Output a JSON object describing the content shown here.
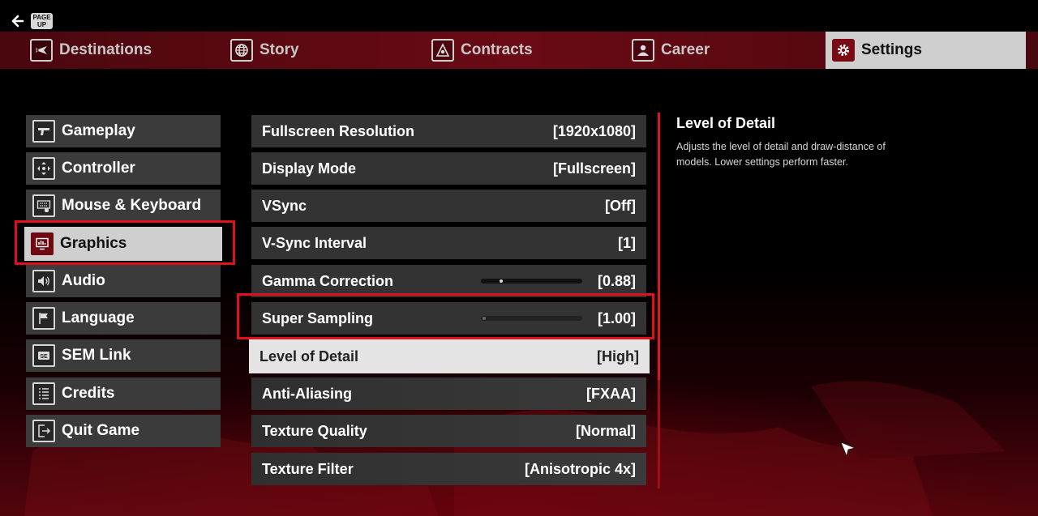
{
  "header": {
    "back_icon": "arrow-left-icon",
    "page_up_key": "PAGE\nUP"
  },
  "nav": {
    "tabs": [
      {
        "label": "Destinations",
        "icon": "airplane-icon"
      },
      {
        "label": "Story",
        "icon": "globe-icon"
      },
      {
        "label": "Contracts",
        "icon": "contracts-icon"
      },
      {
        "label": "Career",
        "icon": "agent-icon"
      },
      {
        "label": "Settings",
        "icon": "gear-icon",
        "active": true
      }
    ]
  },
  "categories": [
    {
      "label": "Gameplay",
      "icon": "pistol-icon"
    },
    {
      "label": "Controller",
      "icon": "dpad-icon"
    },
    {
      "label": "Mouse & Keyboard",
      "icon": "keyboard-icon"
    },
    {
      "label": "Graphics",
      "icon": "monitor-icon",
      "active": true
    },
    {
      "label": "Audio",
      "icon": "speaker-icon"
    },
    {
      "label": "Language",
      "icon": "flag-icon"
    },
    {
      "label": "SEM Link",
      "icon": "sem-icon"
    },
    {
      "label": "Credits",
      "icon": "list-icon"
    },
    {
      "label": "Quit Game",
      "icon": "exit-icon"
    }
  ],
  "settings": [
    {
      "label": "Fullscreen Resolution",
      "value": "[1920x1080]"
    },
    {
      "label": "Display Mode",
      "value": "[Fullscreen]"
    },
    {
      "label": "VSync",
      "value": "[Off]"
    },
    {
      "label": "V-Sync Interval",
      "value": "[1]"
    },
    {
      "label": "Gamma Correction",
      "value": "[0.88]",
      "slider_fraction": 0.18
    },
    {
      "label": "Super Sampling",
      "value": "[1.00]",
      "slider_fraction": 0.0
    },
    {
      "label": "Level of Detail",
      "value": "[High]",
      "selected": true
    },
    {
      "label": "Anti-Aliasing",
      "value": "[FXAA]"
    },
    {
      "label": "Texture Quality",
      "value": "[Normal]"
    },
    {
      "label": "Texture Filter",
      "value": "[Anisotropic 4x]"
    }
  ],
  "description": {
    "title": "Level of Detail",
    "text": "Adjusts the level of detail and draw-distance of models. Lower settings perform faster."
  },
  "colors": {
    "accent_red": "#e0101c",
    "nav_bar": "#6a0a14",
    "selected_bg": "#cfcfcf"
  }
}
